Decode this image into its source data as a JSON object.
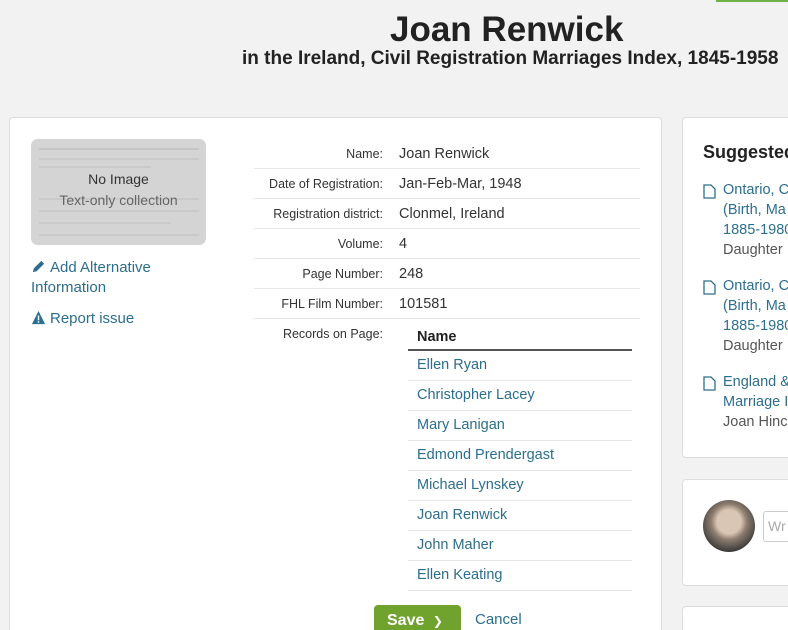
{
  "header": {
    "title": "Joan Renwick",
    "subtitle": "in the Ireland, Civil Registration Marriages Index, 1845-1958"
  },
  "image_panel": {
    "no_image": "No Image",
    "text_only": "Text-only collection"
  },
  "links": {
    "add_alternative": "Add Alternative Information",
    "report_issue": "Report issue"
  },
  "details": [
    {
      "label": "Name:",
      "value": "Joan Renwick"
    },
    {
      "label": "Date of Registration:",
      "value": "Jan-Feb-Mar, 1948"
    },
    {
      "label": "Registration district:",
      "value": "Clonmel, Ireland"
    },
    {
      "label": "Volume:",
      "value": "4"
    },
    {
      "label": "Page Number:",
      "value": "248"
    },
    {
      "label": "FHL Film Number:",
      "value": "101581"
    }
  ],
  "records": {
    "label": "Records on Page:",
    "header": "Name",
    "names": [
      "Ellen Ryan",
      "Christopher Lacey",
      "Mary Lanigan",
      "Edmond Prendergast",
      "Michael Lynskey",
      "Joan Renwick",
      "John Maher",
      "Ellen Keating"
    ]
  },
  "actions": {
    "save": "Save",
    "cancel": "Cancel"
  },
  "suggested": {
    "heading": "Suggested",
    "items": [
      {
        "line1": "Ontario, C",
        "line2": "(Birth, Ma",
        "line3": "1885-1980",
        "sub": "Daughter"
      },
      {
        "line1": "Ontario, C",
        "line2": "(Birth, Ma",
        "line3": "1885-1980",
        "sub": "Daughter"
      },
      {
        "line1": "England &",
        "line2": "Marriage I",
        "sub": "Joan Hinc"
      }
    ]
  },
  "comment": {
    "placeholder": "Wr"
  },
  "colors": {
    "link": "#2c6e8e",
    "save_button": "#6fa32e",
    "accent": "#6fb346"
  }
}
